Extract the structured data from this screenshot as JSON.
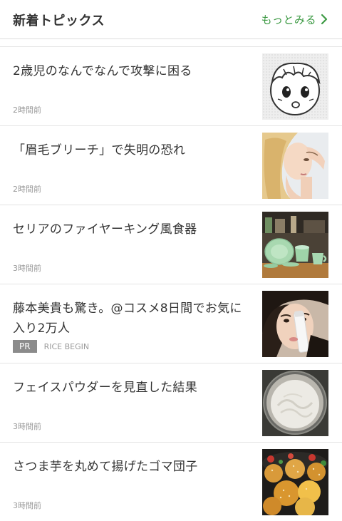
{
  "header": {
    "title": "新着トピックス",
    "more_label": "もっとみる",
    "accent_color": "#3d9a44",
    "more_icon": "chevron-right-icon"
  },
  "topics": [
    {
      "title": "2歳児のなんでなんで攻撃に困る",
      "time": "2時間前",
      "thumb": "illustration-child-face"
    },
    {
      "title": "「眉毛ブリーチ」で失明の恐れ",
      "time": "2時間前",
      "thumb": "woman-touching-eyebrow"
    },
    {
      "title": "セリアのファイヤーキング風食器",
      "time": "3時間前",
      "thumb": "jade-tableware"
    },
    {
      "title": "藤本美貴も驚き。@コスメ8日間でお気に入り2万人",
      "pr_label": "PR",
      "sponsor": "RICE BEGIN",
      "thumb": "woman-with-cosmetic"
    },
    {
      "title": "フェイスパウダーを見直した結果",
      "time": "3時間前",
      "thumb": "face-powder-compact"
    },
    {
      "title": "さつま芋を丸めて揚げたゴマ団子",
      "time": "3時間前",
      "thumb": "fried-sesame-balls"
    }
  ]
}
